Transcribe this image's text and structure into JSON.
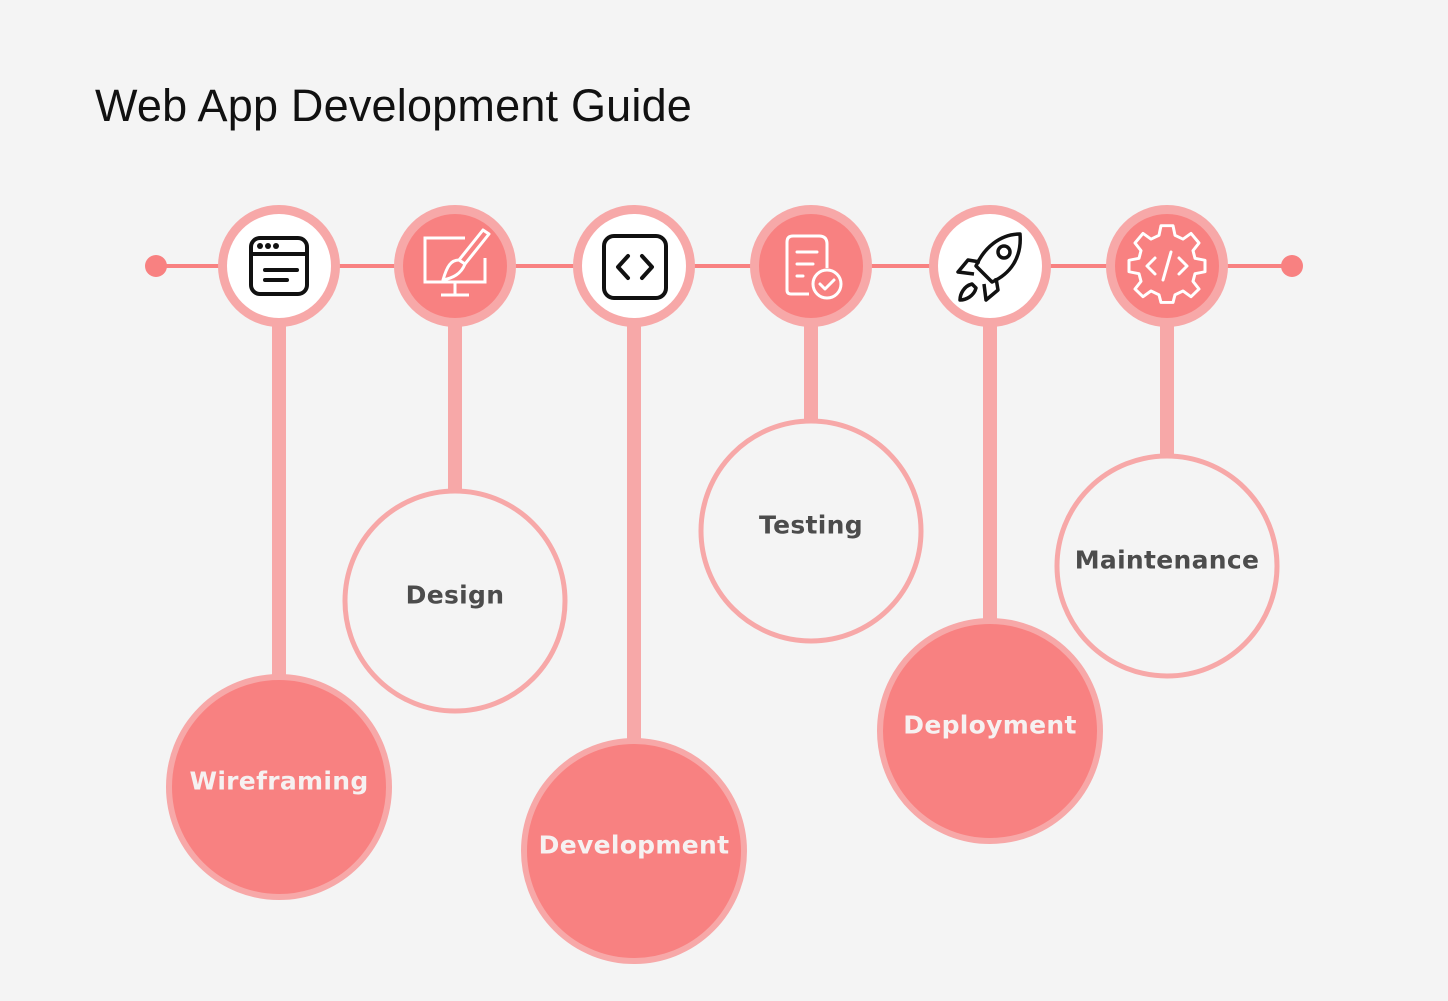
{
  "title": "Web App Development Guide",
  "colors": {
    "background": "#f4f4f4",
    "accent": "#f88181",
    "accent_light": "#f7a8a8",
    "label_dark": "#4c4c4c",
    "label_light": "#f6f1f1"
  },
  "steps": [
    {
      "label": "Wireframing",
      "icon": "browser-window-icon",
      "node_style": "white",
      "bubble_style": "filled"
    },
    {
      "label": "Design",
      "icon": "monitor-paintbrush-icon",
      "node_style": "filled",
      "bubble_style": "outline"
    },
    {
      "label": "Development",
      "icon": "code-brackets-icon",
      "node_style": "white",
      "bubble_style": "filled"
    },
    {
      "label": "Testing",
      "icon": "document-check-icon",
      "node_style": "filled",
      "bubble_style": "outline"
    },
    {
      "label": "Deployment",
      "icon": "rocket-icon",
      "node_style": "white",
      "bubble_style": "filled"
    },
    {
      "label": "Maintenance",
      "icon": "gear-code-icon",
      "node_style": "filled",
      "bubble_style": "outline"
    }
  ]
}
